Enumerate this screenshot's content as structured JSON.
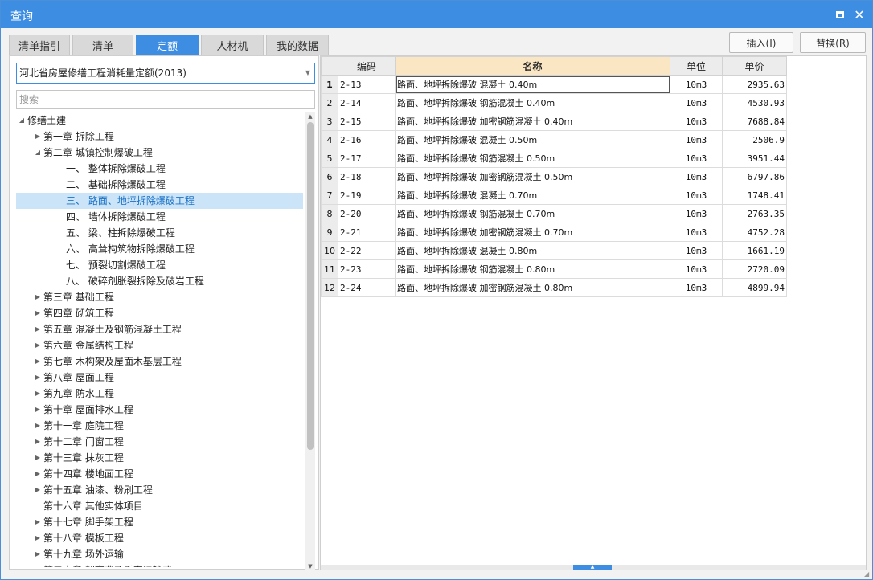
{
  "window": {
    "title": "查询"
  },
  "tabs": [
    {
      "label": "清单指引",
      "active": false
    },
    {
      "label": "清单",
      "active": false
    },
    {
      "label": "定额",
      "active": true
    },
    {
      "label": "人材机",
      "active": false
    },
    {
      "label": "我的数据",
      "active": false
    }
  ],
  "actions": {
    "insert_label": "插入(I)",
    "replace_label": "替换(R)"
  },
  "library_select": {
    "value": "河北省房屋修缮工程消耗量定额(2013)"
  },
  "search": {
    "placeholder": "搜索"
  },
  "tree": [
    {
      "label": "修缮土建",
      "level": 0,
      "arrow": "open"
    },
    {
      "label": "第一章 拆除工程",
      "level": 1,
      "arrow": "closed"
    },
    {
      "label": "第二章 城镇控制爆破工程",
      "level": 1,
      "arrow": "open"
    },
    {
      "label": "一、 整体拆除爆破工程",
      "level": 2,
      "arrow": "none"
    },
    {
      "label": "二、 基础拆除爆破工程",
      "level": 2,
      "arrow": "none"
    },
    {
      "label": "三、 路面、地坪拆除爆破工程",
      "level": 2,
      "arrow": "none",
      "selected": true
    },
    {
      "label": "四、 墙体拆除爆破工程",
      "level": 2,
      "arrow": "none"
    },
    {
      "label": "五、 梁、柱拆除爆破工程",
      "level": 2,
      "arrow": "none"
    },
    {
      "label": "六、 高耸构筑物拆除爆破工程",
      "level": 2,
      "arrow": "none"
    },
    {
      "label": "七、 预裂切割爆破工程",
      "level": 2,
      "arrow": "none"
    },
    {
      "label": "八、 破碎剂胀裂拆除及破岩工程",
      "level": 2,
      "arrow": "none"
    },
    {
      "label": "第三章 基础工程",
      "level": 1,
      "arrow": "closed"
    },
    {
      "label": "第四章 砌筑工程",
      "level": 1,
      "arrow": "closed"
    },
    {
      "label": "第五章 混凝土及钢筋混凝土工程",
      "level": 1,
      "arrow": "closed"
    },
    {
      "label": "第六章 金属结构工程",
      "level": 1,
      "arrow": "closed"
    },
    {
      "label": "第七章 木构架及屋面木基层工程",
      "level": 1,
      "arrow": "closed"
    },
    {
      "label": "第八章 屋面工程",
      "level": 1,
      "arrow": "closed"
    },
    {
      "label": "第九章 防水工程",
      "level": 1,
      "arrow": "closed"
    },
    {
      "label": "第十章 屋面排水工程",
      "level": 1,
      "arrow": "closed"
    },
    {
      "label": "第十一章 庭院工程",
      "level": 1,
      "arrow": "closed"
    },
    {
      "label": "第十二章 门窗工程",
      "level": 1,
      "arrow": "closed"
    },
    {
      "label": "第十三章 抹灰工程",
      "level": 1,
      "arrow": "closed"
    },
    {
      "label": "第十四章 楼地面工程",
      "level": 1,
      "arrow": "closed"
    },
    {
      "label": "第十五章 油漆、粉刷工程",
      "level": 1,
      "arrow": "closed"
    },
    {
      "label": "第十六章 其他实体项目",
      "level": 1,
      "arrow": "none"
    },
    {
      "label": "第十七章 脚手架工程",
      "level": 1,
      "arrow": "closed"
    },
    {
      "label": "第十八章 模板工程",
      "level": 1,
      "arrow": "closed"
    },
    {
      "label": "第十九章 场外运输",
      "level": 1,
      "arrow": "closed"
    },
    {
      "label": "第二十章 超高费及垂直运输费",
      "level": 1,
      "arrow": "closed"
    }
  ],
  "table": {
    "headers": {
      "code": "编码",
      "name": "名称",
      "unit": "单位",
      "price": "单价"
    },
    "rows": [
      {
        "num": "1",
        "code": "2-13",
        "name": "路面、地坪拆除爆破 混凝土 0.40m",
        "unit": "10m3",
        "price": "2935.63"
      },
      {
        "num": "2",
        "code": "2-14",
        "name": "路面、地坪拆除爆破 钢筋混凝土 0.40m",
        "unit": "10m3",
        "price": "4530.93"
      },
      {
        "num": "3",
        "code": "2-15",
        "name": "路面、地坪拆除爆破 加密钢筋混凝土 0.40m",
        "unit": "10m3",
        "price": "7688.84"
      },
      {
        "num": "4",
        "code": "2-16",
        "name": "路面、地坪拆除爆破 混凝土 0.50m",
        "unit": "10m3",
        "price": "2506.9"
      },
      {
        "num": "5",
        "code": "2-17",
        "name": "路面、地坪拆除爆破 钢筋混凝土 0.50m",
        "unit": "10m3",
        "price": "3951.44"
      },
      {
        "num": "6",
        "code": "2-18",
        "name": "路面、地坪拆除爆破 加密钢筋混凝土 0.50m",
        "unit": "10m3",
        "price": "6797.86"
      },
      {
        "num": "7",
        "code": "2-19",
        "name": "路面、地坪拆除爆破 混凝土 0.70m",
        "unit": "10m3",
        "price": "1748.41"
      },
      {
        "num": "8",
        "code": "2-20",
        "name": "路面、地坪拆除爆破 钢筋混凝土 0.70m",
        "unit": "10m3",
        "price": "2763.35"
      },
      {
        "num": "9",
        "code": "2-21",
        "name": "路面、地坪拆除爆破 加密钢筋混凝土 0.70m",
        "unit": "10m3",
        "price": "4752.28"
      },
      {
        "num": "10",
        "code": "2-22",
        "name": "路面、地坪拆除爆破 混凝土 0.80m",
        "unit": "10m3",
        "price": "1661.19"
      },
      {
        "num": "11",
        "code": "2-23",
        "name": "路面、地坪拆除爆破 钢筋混凝土 0.80m",
        "unit": "10m3",
        "price": "2720.09"
      },
      {
        "num": "12",
        "code": "2-24",
        "name": "路面、地坪拆除爆破 加密钢筋混凝土 0.80m",
        "unit": "10m3",
        "price": "4899.94"
      }
    ]
  },
  "icons": {
    "maximize": "maximize-icon",
    "close": "close-icon",
    "dropdown": "chevron-down-icon",
    "expanded": "triangle-down-icon",
    "collapsed": "triangle-right-icon"
  },
  "colors": {
    "accent": "#3d8ee3",
    "selected_row": "#cce4f7",
    "name_header": "#fbe6c4"
  }
}
